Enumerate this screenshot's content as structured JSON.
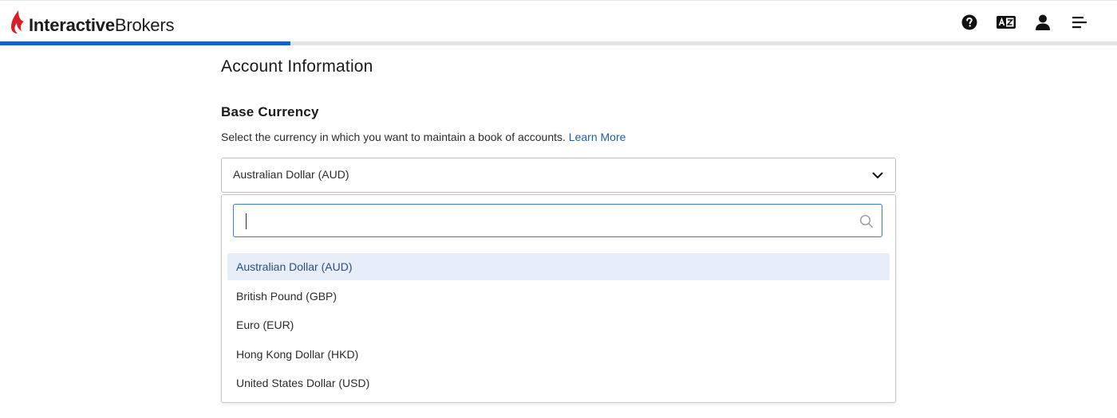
{
  "header": {
    "logo_text_bold": "Interactive",
    "logo_text_regular": "Brokers",
    "progress_fraction": 0.26,
    "colors": {
      "accent": "#1a5fc9",
      "brand_red": "#d81f26",
      "link": "#1f5fa8"
    },
    "icons": [
      "help-circle-icon",
      "language-icon",
      "user-icon",
      "menu-icon"
    ]
  },
  "main": {
    "page_title": "Account Information",
    "section_title": "Base Currency",
    "description": "Select the currency in which you want to maintain a book of accounts.",
    "learn_more": "Learn More",
    "select": {
      "value": "Australian Dollar (AUD)",
      "search_value": "",
      "options": [
        "Australian Dollar (AUD)",
        "British Pound (GBP)",
        "Euro (EUR)",
        "Hong Kong Dollar (HKD)",
        "United States Dollar (USD)"
      ],
      "selected_index": 0
    }
  }
}
